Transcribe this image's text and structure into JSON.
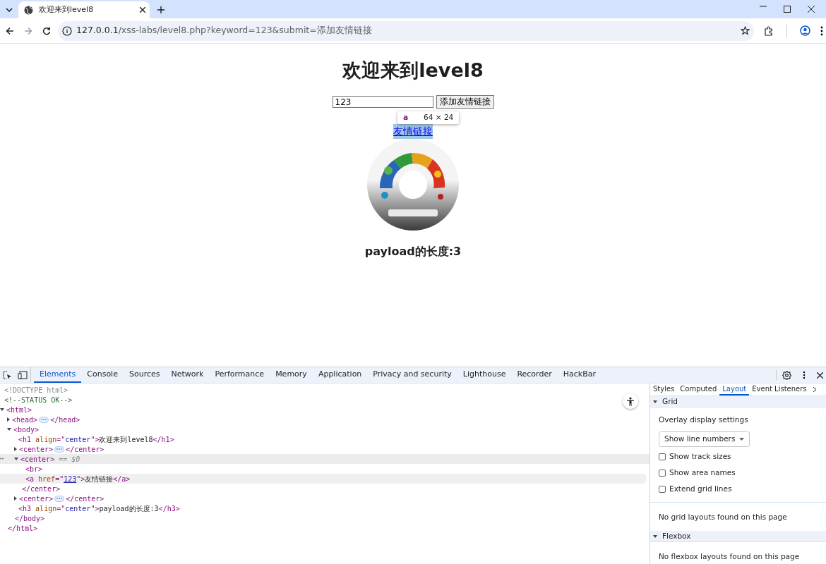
{
  "browser": {
    "tabs": [
      {
        "title": "欢迎来到level8",
        "selected": true
      }
    ],
    "address": {
      "host": "127.0.0.1",
      "path": "/xss-labs/level8.php?keyword=123&submit=添加友情链接"
    }
  },
  "page": {
    "heading": "欢迎来到level8",
    "input_value": "123",
    "button": "添加友情链接",
    "link": "友情链接",
    "link_highlighted": true,
    "footer": "payload的长度:3"
  },
  "inspect_tooltip": {
    "tag": "a",
    "size": "64 × 24"
  },
  "devtools": {
    "tabs": [
      {
        "label": "Elements",
        "selected": true
      },
      {
        "label": "Console",
        "selected": false
      },
      {
        "label": "Sources",
        "selected": false
      },
      {
        "label": "Network",
        "selected": false
      },
      {
        "label": "Performance",
        "selected": false
      },
      {
        "label": "Memory",
        "selected": false
      },
      {
        "label": "Application",
        "selected": false
      },
      {
        "label": "Privacy and security",
        "selected": false
      },
      {
        "label": "Lighthouse",
        "selected": false
      },
      {
        "label": "Recorder",
        "selected": false
      },
      {
        "label": "HackBar",
        "selected": false
      }
    ],
    "tree": [
      {
        "parts": [
          {
            "kind": "doctype",
            "text": "<!DOCTYPE html>"
          }
        ],
        "selected": false,
        "hovered": false
      },
      {
        "parts": [
          {
            "kind": "comment",
            "text": "<!--STATUS OK-->"
          }
        ],
        "selected": false,
        "hovered": false
      },
      {
        "parts": [
          {
            "kind": "tag",
            "text": "<html>"
          }
        ],
        "selected": false,
        "hovered": false,
        "expanded": true,
        "close": [
          {
            "kind": "tag",
            "text": "</html>"
          }
        ],
        "children": [
          {
            "parts": [
              {
                "kind": "tag",
                "text": "<head>"
              },
              {
                "kind": "collapsed"
              },
              {
                "kind": "tag",
                "text": "</head>"
              }
            ],
            "selected": false,
            "hovered": false,
            "expanded": false
          },
          {
            "parts": [
              {
                "kind": "tag",
                "text": "<body>"
              }
            ],
            "selected": false,
            "hovered": false,
            "expanded": true,
            "close": [
              {
                "kind": "tag",
                "text": "</body>"
              }
            ],
            "children": [
              {
                "parts": [
                  {
                    "kind": "tag",
                    "text": "<h1 "
                  },
                  {
                    "kind": "attr",
                    "text": "align"
                  },
                  {
                    "kind": "tag",
                    "text": "=\""
                  },
                  {
                    "kind": "value",
                    "text": "center"
                  },
                  {
                    "kind": "tag",
                    "text": "\">"
                  },
                  {
                    "kind": "text",
                    "text": "欢迎来到level8"
                  },
                  {
                    "kind": "tag",
                    "text": "</h1>"
                  }
                ],
                "selected": false,
                "hovered": false
              },
              {
                "parts": [
                  {
                    "kind": "tag",
                    "text": "<center>"
                  },
                  {
                    "kind": "collapsed"
                  },
                  {
                    "kind": "tag",
                    "text": "</center>"
                  }
                ],
                "selected": false,
                "hovered": false,
                "expanded": false
              },
              {
                "parts": [
                  {
                    "kind": "tag",
                    "text": "<center>"
                  },
                  {
                    "kind": "ref",
                    "text": " == $0"
                  }
                ],
                "selected": true,
                "hovered": false,
                "expanded": true,
                "close": [
                  {
                    "kind": "tag",
                    "text": "</center>"
                  }
                ],
                "children": [
                  {
                    "parts": [
                      {
                        "kind": "tag",
                        "text": "<br>"
                      }
                    ],
                    "selected": false,
                    "hovered": false
                  },
                  {
                    "parts": [
                      {
                        "kind": "tag",
                        "text": "<a "
                      },
                      {
                        "kind": "attr",
                        "text": "href"
                      },
                      {
                        "kind": "tag",
                        "text": "=\""
                      },
                      {
                        "kind": "link",
                        "text": "123"
                      },
                      {
                        "kind": "tag",
                        "text": "\">"
                      },
                      {
                        "kind": "text",
                        "text": "友情链接"
                      },
                      {
                        "kind": "tag",
                        "text": "</a>"
                      }
                    ],
                    "selected": false,
                    "hovered": true
                  }
                ]
              },
              {
                "parts": [
                  {
                    "kind": "tag",
                    "text": "<center>"
                  },
                  {
                    "kind": "collapsed"
                  },
                  {
                    "kind": "tag",
                    "text": "</center>"
                  }
                ],
                "selected": false,
                "hovered": false,
                "expanded": false
              },
              {
                "parts": [
                  {
                    "kind": "tag",
                    "text": "<h3 "
                  },
                  {
                    "kind": "attr",
                    "text": "align"
                  },
                  {
                    "kind": "tag",
                    "text": "=\""
                  },
                  {
                    "kind": "value",
                    "text": "center"
                  },
                  {
                    "kind": "tag",
                    "text": "\">"
                  },
                  {
                    "kind": "text",
                    "text": "payload的长度:3"
                  },
                  {
                    "kind": "tag",
                    "text": "</h3>"
                  }
                ],
                "selected": false,
                "hovered": false
              }
            ]
          }
        ]
      }
    ],
    "side_tabs": [
      {
        "label": "Styles",
        "selected": false
      },
      {
        "label": "Computed",
        "selected": false
      },
      {
        "label": "Layout",
        "selected": true
      },
      {
        "label": "Event Listeners",
        "selected": false
      }
    ],
    "sections": [
      {
        "title": "Grid",
        "expanded": true,
        "items": [
          {
            "kind": "label",
            "text": "Overlay display settings"
          },
          {
            "kind": "select",
            "text": "Show line numbers"
          },
          {
            "kind": "checkbox",
            "text": "Show track sizes",
            "checked": false
          },
          {
            "kind": "checkbox",
            "text": "Show area names",
            "checked": false
          },
          {
            "kind": "checkbox",
            "text": "Extend grid lines",
            "checked": false
          },
          {
            "kind": "note",
            "text": "No grid layouts found on this page"
          }
        ]
      },
      {
        "title": "Flexbox",
        "expanded": true,
        "items": [
          {
            "kind": "note",
            "text": "No flexbox layouts found on this page"
          }
        ]
      }
    ]
  }
}
